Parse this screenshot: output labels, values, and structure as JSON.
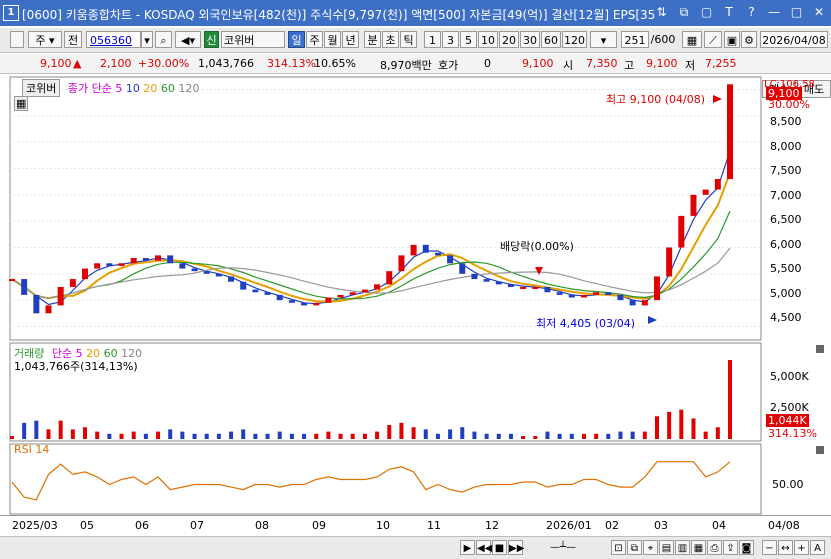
{
  "window": {
    "app_number": "1",
    "title": "[0600] 키움종합차트 - KOSDAQ 외국인보유[482(천)] 주식수[9,797(천)] 액면[500] 자본금[49(억)] 결산[12월] EPS[35"
  },
  "toolbar": {
    "type_label": "주",
    "prev_label": "전",
    "stock_code": "056360",
    "market_badge": "신",
    "stock_name": "코위버",
    "periods": [
      "일",
      "주",
      "월",
      "년",
      "분",
      "초",
      "틱"
    ],
    "minutes": [
      "1",
      "3",
      "5",
      "10",
      "20",
      "30",
      "60",
      "120"
    ],
    "count": "251",
    "count_total": "/600",
    "date": "2026/04/08"
  },
  "info": {
    "price": "9,100",
    "change": "2,100",
    "change_pct": "+30.00%",
    "volume": "1,043,766",
    "volume_ratio": "314.13%",
    "turnover": "10.65%",
    "amount": "8,970백만",
    "quote_label": "호가",
    "quote_value": "0",
    "quote_price": "9,100",
    "open_label": "시",
    "open": "7,350",
    "high_label": "고",
    "high": "9,100",
    "low_label": "저",
    "low": "7,255"
  },
  "side": {
    "buy": "매수",
    "sell": "매도"
  },
  "price_panel": {
    "stock_tag": "코위버",
    "ma_label": "종가 단순",
    "ma_periods": [
      "5",
      "10",
      "20",
      "60",
      "120"
    ],
    "ma_colors": [
      "#cc00cc",
      "#1f3fbf",
      "#e6a000",
      "#2a9a2a",
      "#999999"
    ],
    "peak_label": "최고 9,100 (04/08)",
    "low_label": "최저 4,405 (03/04)",
    "dividend_label": "배당락(0.00%)",
    "current_price": "9,100",
    "current_pct": "30.00%",
    "top_clip_label": "LC:106.58",
    "yticks": [
      "9,000",
      "8,500",
      "8,000",
      "7,500",
      "7,000",
      "6,500",
      "6,000",
      "5,500",
      "5,000",
      "4,500"
    ]
  },
  "volume_panel": {
    "title": "거래량",
    "ma_label": "단순",
    "ma_periods": [
      "5",
      "20",
      "60",
      "120"
    ],
    "current": "1,043,766주(314,13%)",
    "yticks": [
      "5,000K",
      "2,500K"
    ],
    "current_badge": "1,044K",
    "ratio_badge": "314.13%"
  },
  "rsi_panel": {
    "title": "RSI 14",
    "ytick": "50.00"
  },
  "xaxis": {
    "labels": [
      "2025/03",
      "05",
      "06",
      "07",
      "08",
      "09",
      "10",
      "11",
      "12",
      "2026/01",
      "02",
      "03",
      "04"
    ],
    "right_label": "04/08"
  },
  "chart_data": {
    "type": "line",
    "title": "",
    "series": [
      {
        "values": [
          5400,
          5100,
          4750,
          4900,
          5250,
          5400,
          5600,
          5700,
          5650,
          5700,
          5800,
          5750,
          5850,
          5700,
          5600,
          5550,
          5500,
          5450,
          5350,
          5200,
          5150,
          5100,
          5000,
          4950,
          4900,
          4950,
          5050,
          5100,
          5150,
          5200,
          5300,
          5550,
          5850,
          6050,
          5900,
          5850,
          5700,
          5500,
          5400,
          5350,
          5300,
          5250,
          5250,
          5250,
          5150,
          5100,
          5050,
          5100,
          5150,
          5100,
          5000,
          4900,
          5000,
          5450,
          6000,
          6600,
          7000,
          7100,
          7300,
          9100
        ]
      }
    ],
    "ylim": [
      4300,
      9200
    ]
  }
}
